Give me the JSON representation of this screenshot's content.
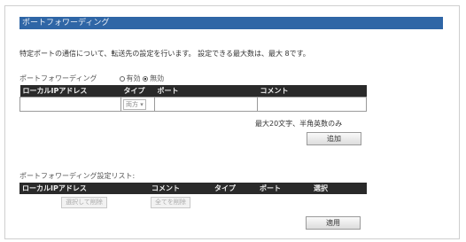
{
  "section_title": "ポートフォワーディング",
  "description": "特定ポートの通信について、転送先の設定を行います。 設定できる最大数は、最大 8です。",
  "port_forwarding": {
    "label": "ポートフォワーディング",
    "options": [
      "有効",
      "無効"
    ],
    "selected": "無効"
  },
  "entry_table": {
    "headers": [
      "ローカルIPアドレス",
      "タイプ",
      "ポート",
      "コメント"
    ],
    "type_value": "両方"
  },
  "comment_note": "最大20文字、半角英数のみ",
  "add_button": "追加",
  "list_section": {
    "label": "ポートフォワーディング設定リスト:",
    "headers": [
      "ローカルIPアドレス",
      "コメント",
      "タイプ",
      "ポート",
      "選択"
    ],
    "delete_selected": "選択して削除",
    "delete_all": "全てを削除"
  },
  "apply_button": "適用"
}
